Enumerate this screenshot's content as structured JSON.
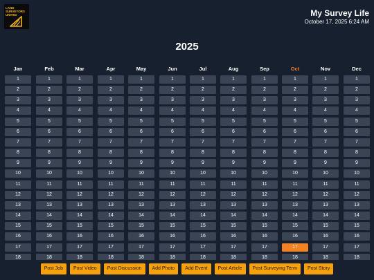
{
  "header": {
    "logo_text": "LAND SURVEYORS UNITED",
    "app_title": "My Survey Life",
    "datetime": "October 17, 2025 6:24 AM"
  },
  "calendar": {
    "year": "2025",
    "current_month_index": 9,
    "today_day": 17,
    "months": [
      {
        "name": "Jan",
        "days": [
          1,
          2,
          3,
          4,
          5,
          6,
          7,
          8,
          9,
          10,
          11,
          12,
          13,
          14,
          15,
          16,
          17,
          18
        ]
      },
      {
        "name": "Feb",
        "days": [
          1,
          2,
          3,
          4,
          5,
          6,
          7,
          8,
          9,
          10,
          11,
          12,
          13,
          14,
          15,
          16,
          17,
          18
        ]
      },
      {
        "name": "Mar",
        "days": [
          1,
          2,
          3,
          4,
          5,
          6,
          7,
          8,
          9,
          10,
          11,
          12,
          13,
          14,
          15,
          16,
          17,
          18
        ]
      },
      {
        "name": "Apr",
        "days": [
          1,
          2,
          3,
          4,
          5,
          6,
          7,
          8,
          9,
          10,
          11,
          12,
          13,
          14,
          15,
          16,
          17,
          18
        ]
      },
      {
        "name": "May",
        "days": [
          1,
          2,
          3,
          4,
          5,
          6,
          7,
          8,
          9,
          10,
          11,
          12,
          13,
          14,
          15,
          16,
          17,
          18
        ]
      },
      {
        "name": "Jun",
        "days": [
          1,
          2,
          3,
          4,
          5,
          6,
          7,
          8,
          9,
          10,
          11,
          12,
          13,
          14,
          15,
          16,
          17,
          18
        ]
      },
      {
        "name": "Jul",
        "days": [
          1,
          2,
          3,
          4,
          5,
          6,
          7,
          8,
          9,
          10,
          11,
          12,
          13,
          14,
          15,
          16,
          17,
          18
        ]
      },
      {
        "name": "Aug",
        "days": [
          1,
          2,
          3,
          4,
          5,
          6,
          7,
          8,
          9,
          10,
          11,
          12,
          13,
          14,
          15,
          16,
          17,
          18
        ]
      },
      {
        "name": "Sep",
        "days": [
          1,
          2,
          3,
          4,
          5,
          6,
          7,
          8,
          9,
          10,
          11,
          12,
          13,
          14,
          15,
          16,
          17,
          18
        ]
      },
      {
        "name": "Oct",
        "days": [
          1,
          2,
          3,
          4,
          5,
          6,
          7,
          8,
          9,
          10,
          11,
          12,
          13,
          14,
          15,
          16,
          17,
          18
        ]
      },
      {
        "name": "Nov",
        "days": [
          1,
          2,
          3,
          4,
          5,
          6,
          7,
          8,
          9,
          10,
          11,
          12,
          13,
          14,
          15,
          16,
          17,
          18
        ]
      },
      {
        "name": "Dec",
        "days": [
          1,
          2,
          3,
          4,
          5,
          6,
          7,
          8,
          9,
          10,
          11,
          12,
          13,
          14,
          15,
          16,
          17,
          18
        ]
      }
    ]
  },
  "actions": [
    {
      "label": "Post Job"
    },
    {
      "label": "Post Video"
    },
    {
      "label": "Post Discussion"
    },
    {
      "label": "Add Photo"
    },
    {
      "label": "Add Event"
    },
    {
      "label": "Post Article"
    },
    {
      "label": "Post Surveying Term"
    },
    {
      "label": "Post Story"
    }
  ],
  "colors": {
    "background": "#16202e",
    "day_cell": "#3a4454",
    "today": "#f58220",
    "current_month": "#f07f2a",
    "action_button": "#f9a100",
    "logo_accent": "#f5b800"
  }
}
